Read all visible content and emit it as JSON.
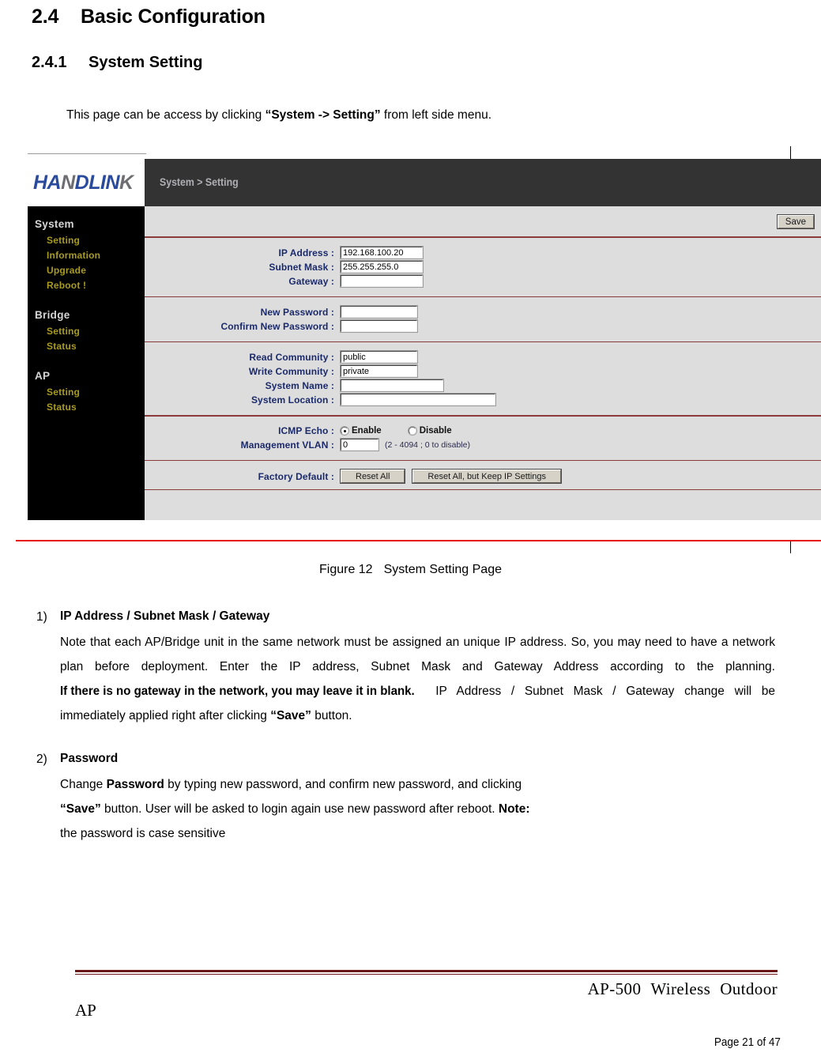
{
  "document": {
    "section_number": "2.4",
    "section_title": "Basic Configuration",
    "subsection_number": "2.4.1",
    "subsection_title": "System Setting",
    "intro_prefix": "This page can be access by clicking ",
    "intro_bold": "“System -> Setting”",
    "intro_suffix": " from left side menu.",
    "figure_caption_label": "Figure 12",
    "figure_caption_text": "System Setting Page"
  },
  "screenshot": {
    "logo": {
      "part1": "HA",
      "part2": "N",
      "part3": "DLIN",
      "part4": "K"
    },
    "breadcrumb": "System > Setting",
    "save_label": "Save",
    "sidebar": [
      {
        "group": "System",
        "items": [
          "Setting",
          "Information",
          "Upgrade",
          "Reboot !"
        ]
      },
      {
        "group": "Bridge",
        "items": [
          "Setting",
          "Status"
        ]
      },
      {
        "group": "AP",
        "items": [
          "Setting",
          "Status"
        ]
      }
    ],
    "network": {
      "ip_label": "IP Address :",
      "ip_value": "192.168.100.20",
      "mask_label": "Subnet Mask :",
      "mask_value": "255.255.255.0",
      "gateway_label": "Gateway :",
      "gateway_value": ""
    },
    "password": {
      "new_label": "New Password :",
      "new_value": "",
      "confirm_label": "Confirm New Password :",
      "confirm_value": ""
    },
    "snmp": {
      "read_label": "Read Community :",
      "read_value": "public",
      "write_label": "Write Community :",
      "write_value": "private",
      "name_label": "System Name :",
      "name_value": "",
      "location_label": "System Location :",
      "location_value": ""
    },
    "misc": {
      "icmp_label": "ICMP Echo :",
      "icmp_enable": "Enable",
      "icmp_disable": "Disable",
      "icmp_selected": "Enable",
      "vlan_label": "Management VLAN :",
      "vlan_value": "0",
      "vlan_hint": "(2 - 4094 ; 0 to disable)"
    },
    "factory": {
      "label": "Factory Default :",
      "reset_all": "Reset All",
      "reset_keep_ip": "Reset All, but Keep IP Settings"
    },
    "colors": {
      "banner": "#333334",
      "sidebar": "#000000",
      "panel": "#dddddd",
      "rule": "#8b3b3b",
      "bottom_rule": "#e81515",
      "label_text": "#1b2a6b",
      "nav_link": "#a99a22",
      "logo_blue": "#2a4a9b"
    }
  },
  "items": [
    {
      "marker": "1)",
      "title": "IP Address / Subnet Mask / Gateway",
      "body_a": "Note that each AP/Bridge unit in the same network must be assigned an unique IP address. So, you may need to have a network plan before deployment. Enter the IP address, Subnet Mask and Gateway Address according to the planning. ",
      "body_emph": "If there is no gateway in the network, you may leave it in blank.",
      "body_b": " IP Address / Subnet Mask / Gateway change will be immediately applied right after clicking ",
      "body_bold": "“Save”",
      "body_c": " button."
    },
    {
      "marker": "2)",
      "title": "Password",
      "line1_a": "Change ",
      "line1_bold": "Password",
      "line1_b": " by typing new password, and confirm new password, and clicking",
      "line2_bold": "“Save”",
      "line2_a": " button. User will be asked to login again use new password after reboot. ",
      "line2_bold2": "Note:",
      "line3": "the password is case sensitive"
    }
  ],
  "footer": {
    "product": "AP-500",
    "type1": "Wireless",
    "type2": "Outdoor",
    "type3": "AP",
    "page": "Page 21 of 47"
  }
}
